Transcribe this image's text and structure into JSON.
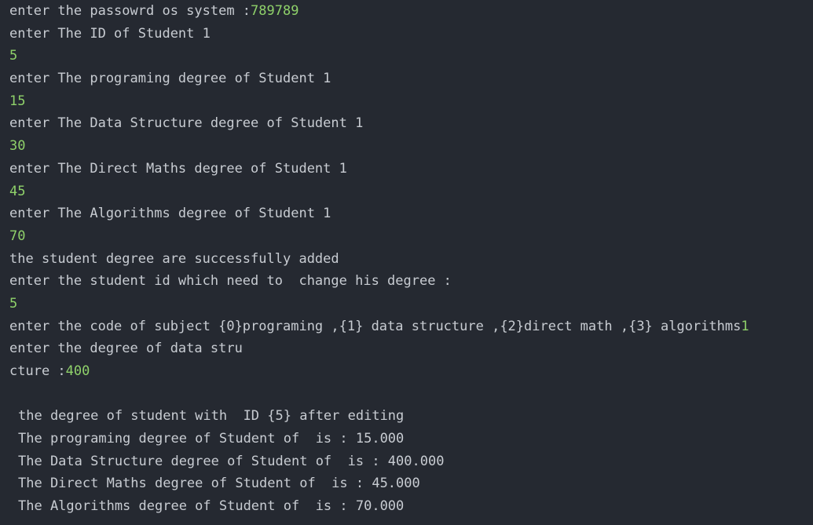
{
  "lines": [
    {
      "prompt": "enter the passowrd os system :",
      "input": "789789"
    },
    {
      "prompt": "enter The ID of Student 1",
      "input": ""
    },
    {
      "prompt": "",
      "input": "5"
    },
    {
      "prompt": "enter The programing degree of Student 1",
      "input": ""
    },
    {
      "prompt": "",
      "input": "15"
    },
    {
      "prompt": "enter The Data Structure degree of Student 1",
      "input": ""
    },
    {
      "prompt": "",
      "input": "30"
    },
    {
      "prompt": "enter The Direct Maths degree of Student 1",
      "input": ""
    },
    {
      "prompt": "",
      "input": "45"
    },
    {
      "prompt": "enter The Algorithms degree of Student 1",
      "input": ""
    },
    {
      "prompt": "",
      "input": "70"
    },
    {
      "prompt": "the student degree are successfully added",
      "input": ""
    },
    {
      "prompt": "enter the student id which need to  change his degree :",
      "input": ""
    },
    {
      "prompt": "",
      "input": "5"
    },
    {
      "prompt": "enter the code of subject {0}programing ,{1} data structure ,{2}direct math ,{3} algorithms",
      "input": "1"
    },
    {
      "prompt": "enter the degree of data stru",
      "input": ""
    },
    {
      "prompt": "cture :",
      "input": "400"
    }
  ],
  "results": [
    "the degree of student with  ID {5} after editing",
    "The programing degree of Student of  is : 15.000",
    "The Data Structure degree of Student of  is : 400.000",
    "The Direct Maths degree of Student of  is : 45.000",
    "The Algorithms degree of Student of  is : 70.000"
  ]
}
